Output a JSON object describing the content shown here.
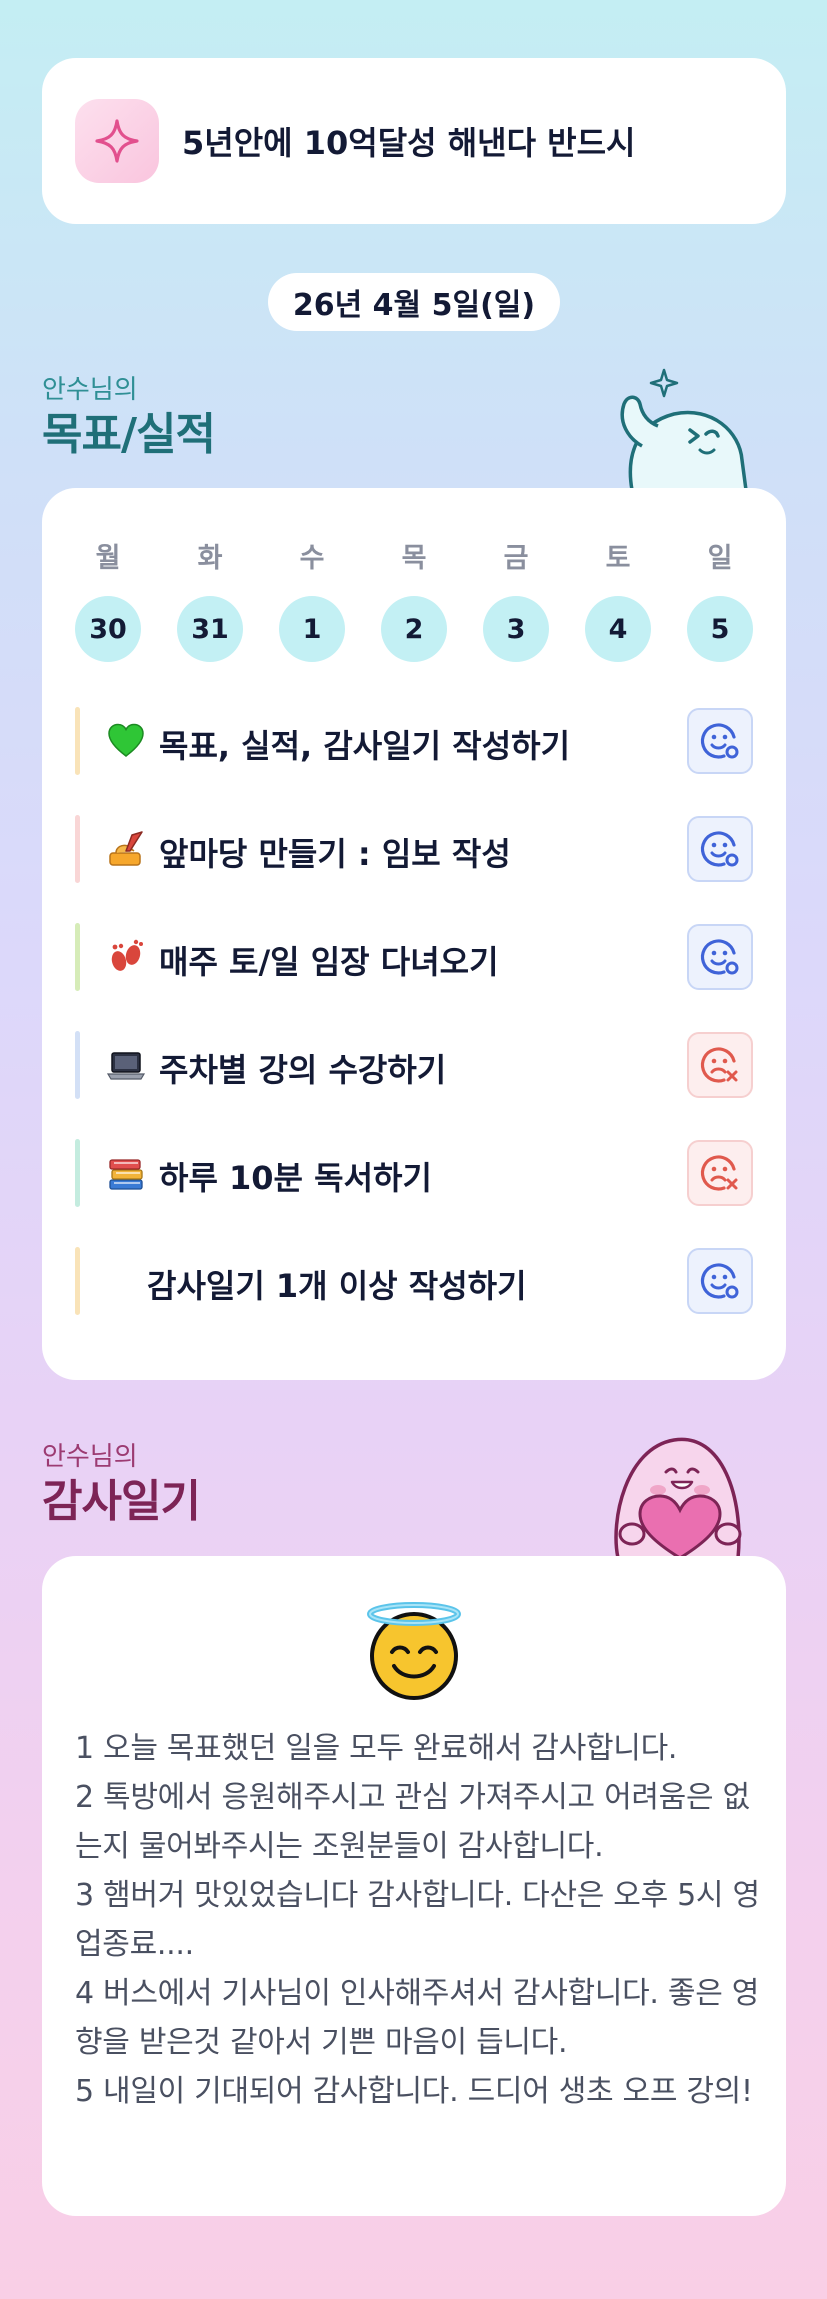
{
  "goal": {
    "icon": "sparkle-icon",
    "text": "5년안에 10억달성 해낸다 반드시"
  },
  "date": "26년 4월 5일(일)",
  "goals_section": {
    "subtitle": "안수님의",
    "title": "목표/실적"
  },
  "week": {
    "days_of_week": [
      "월",
      "화",
      "수",
      "목",
      "금",
      "토",
      "일"
    ],
    "dates": [
      "30",
      "31",
      "1",
      "2",
      "3",
      "4",
      "5"
    ]
  },
  "tasks": [
    {
      "label": "목표, 실적, 감사일기 작성하기",
      "emoji": "green-heart-icon",
      "bar_color": "#f9e3b8",
      "status": "done"
    },
    {
      "label": "앞마당 만들기 : 임보 작성",
      "emoji": "writing-hand-icon",
      "bar_color": "#f9d6d6",
      "status": "done"
    },
    {
      "label": "매주 토/일 임장 다녀오기",
      "emoji": "footprints-icon",
      "bar_color": "#d6ecb8",
      "status": "done"
    },
    {
      "label": "주차별 강의 수강하기",
      "emoji": "laptop-icon",
      "bar_color": "#d3e0f6",
      "status": "missed"
    },
    {
      "label": "하루 10분 독서하기",
      "emoji": "books-icon",
      "bar_color": "#c4ecdf",
      "status": "missed"
    },
    {
      "label": "감사일기 1개 이상 작성하기",
      "emoji": "",
      "bar_color": "#f9e3b8",
      "status": "done"
    }
  ],
  "gratitude_section": {
    "subtitle": "안수님의",
    "title": "감사일기"
  },
  "gratitude": {
    "emoji": "smiling-face-with-halo-icon",
    "lines": [
      "1 오늘 목표했던 일을 모두 완료해서 감사합니다.",
      "2 톡방에서 응원해주시고 관심 가져주시고 어려움은 없는지 물어봐주시는 조원분들이 감사합니다.",
      "3 햄버거 맛있었습니다 감사합니다. 다산은 오후 5시 영업종료....",
      "4 버스에서 기사님이 인사해주셔서 감사합니다. 좋은 영향을 받은것 같아서 기쁜 마음이 듭니다.",
      "5 내일이 기대되어 감사합니다. 드디어 생초 오프 강의!"
    ]
  },
  "colors": {
    "accent_teal": "#1f6f78",
    "accent_plum": "#7d2456",
    "done_icon": "#3f63d8",
    "missed_icon": "#e0594d"
  }
}
